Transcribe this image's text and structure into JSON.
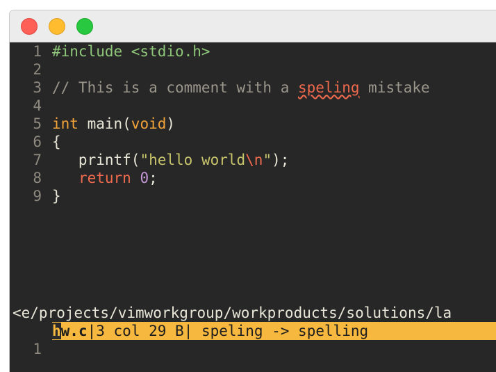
{
  "window": {
    "controls": [
      "close",
      "minimize",
      "maximize"
    ]
  },
  "editor": {
    "lines": [
      {
        "num": "1",
        "tokens": [
          {
            "t": "#include <stdio.h>",
            "c": "pp"
          }
        ]
      },
      {
        "num": "2",
        "tokens": []
      },
      {
        "num": "3",
        "tokens": [
          {
            "t": "// This is a comment with a ",
            "c": "cm"
          },
          {
            "t": "speling",
            "c": "sp"
          },
          {
            "t": " mistake",
            "c": "cm"
          }
        ]
      },
      {
        "num": "4",
        "tokens": []
      },
      {
        "num": "5",
        "tokens": [
          {
            "t": "int",
            "c": "ty"
          },
          {
            "t": " main(",
            "c": ""
          },
          {
            "t": "void",
            "c": "ty"
          },
          {
            "t": ")",
            "c": ""
          }
        ]
      },
      {
        "num": "6",
        "tokens": [
          {
            "t": "{",
            "c": ""
          }
        ]
      },
      {
        "num": "7",
        "tokens": [
          {
            "t": "   printf(",
            "c": ""
          },
          {
            "t": "\"hello world",
            "c": "st"
          },
          {
            "t": "\\n",
            "c": "esc"
          },
          {
            "t": "\"",
            "c": "st"
          },
          {
            "t": ");",
            "c": ""
          }
        ]
      },
      {
        "num": "8",
        "tokens": [
          {
            "t": "   ",
            "c": ""
          },
          {
            "t": "return",
            "c": "kw"
          },
          {
            "t": " ",
            "c": ""
          },
          {
            "t": "0",
            "c": "num"
          },
          {
            "t": ";",
            "c": ""
          }
        ]
      },
      {
        "num": "9",
        "tokens": [
          {
            "t": "}",
            "c": ""
          }
        ]
      }
    ],
    "path": "<e/projects/vimworkgroup/workproducts/solutions/la",
    "status": {
      "line_num": "1",
      "cursor_char": "h",
      "filename_rest": "w.c",
      "position": "3 col 29 B",
      "message": " speling -> spelling"
    }
  },
  "colors": {
    "background": "#272727",
    "statusbar": "#f6b83e",
    "keyword": "#f06a4d",
    "type": "#f2a33a",
    "string": "#c8c46b",
    "preprocessor": "#8fc77a",
    "comment": "#9c978c",
    "number": "#c497d6"
  }
}
